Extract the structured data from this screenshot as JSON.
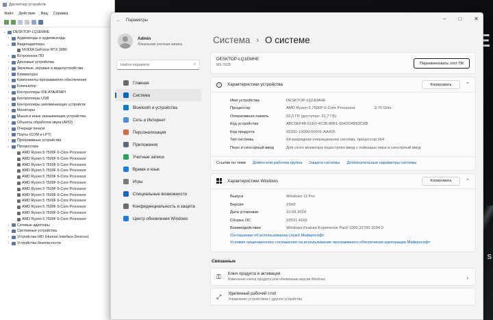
{
  "device_manager": {
    "title": "Диспетчер устройств",
    "menu": [
      "Файл",
      "Действие",
      "Вид",
      "Справка"
    ],
    "root": "DESKTOP-LQ1EMHE",
    "categories": [
      {
        "label": "Аудиовходы и аудиовыходы",
        "expanded": false
      },
      {
        "label": "Видеоадаптеры",
        "expanded": true
      },
      {
        "label": "NVIDIA GeForce RTX 3080",
        "child": true
      },
      {
        "label": "Встроенное ПО",
        "expanded": false
      },
      {
        "label": "Дисковые устройства",
        "expanded": false
      },
      {
        "label": "Звуковые, игровые и видеоустройства",
        "expanded": false
      },
      {
        "label": "Клавиатуры",
        "expanded": false
      },
      {
        "label": "Компоненты программного обеспечения",
        "expanded": false
      },
      {
        "label": "Компьютер",
        "expanded": false
      },
      {
        "label": "Контроллеры IDE ATA/ATAPI",
        "expanded": false
      },
      {
        "label": "Контроллеры USB",
        "expanded": false
      },
      {
        "label": "Контроллеры запоминающих устройств",
        "expanded": false
      },
      {
        "label": "Мониторы",
        "expanded": false
      },
      {
        "label": "Мыши и иные указывающие устройства",
        "expanded": false
      },
      {
        "label": "Объекты обработки звука (APO)",
        "expanded": false
      },
      {
        "label": "Очереди печати",
        "expanded": false
      },
      {
        "label": "Порты (COM и LPT)",
        "expanded": false
      },
      {
        "label": "Программные устройства",
        "expanded": false
      },
      {
        "label": "Процессоры",
        "expanded": true
      }
    ],
    "processors": [
      "AMD Ryzen 5 7500F 6-Core Processor",
      "AMD Ryzen 5 7500F 6-Core Processor",
      "AMD Ryzen 5 7500F 6-Core Processor",
      "AMD Ryzen 5 7500F 6-Core Processor",
      "AMD Ryzen 5 7500F 6-Core Processor",
      "AMD Ryzen 5 7500F 6-Core Processor",
      "AMD Ryzen 5 7500F 6-Core Processor",
      "AMD Ryzen 5 7500F 6-Core Processor",
      "AMD Ryzen 5 7500F 6-Core Processor",
      "AMD Ryzen 5 7500F 6-Core Processor",
      "AMD Ryzen 5 7500F 6-Core Processor",
      "AMD Ryzen 5 7500F 6-Core Processor"
    ],
    "tail_categories": [
      "Сетевые адаптеры",
      "Системные устройства",
      "Устройства HID (Human Interface Devices)",
      "Устройства безопасности"
    ]
  },
  "settings": {
    "title": "Параметры",
    "user": {
      "name": "Admin",
      "sub": "Локальная учетная запись"
    },
    "search_placeholder": "Найти параметр",
    "nav": [
      {
        "label": "Главная",
        "icon": "home-icon",
        "color": "#6b6b6b"
      },
      {
        "label": "Система",
        "icon": "system-icon",
        "color": "#0067c0",
        "active": true
      },
      {
        "label": "Bluetooth и устройства",
        "icon": "bluetooth-icon",
        "color": "#0a7ad1"
      },
      {
        "label": "Сеть и Интернет",
        "icon": "network-icon",
        "color": "#4a8fd6"
      },
      {
        "label": "Персонализация",
        "icon": "brush-icon",
        "color": "#d46a43"
      },
      {
        "label": "Приложения",
        "icon": "apps-icon",
        "color": "#5a6a80"
      },
      {
        "label": "Учетные записи",
        "icon": "account-icon",
        "color": "#2ba35c"
      },
      {
        "label": "Время и язык",
        "icon": "globe-icon",
        "color": "#1a7fd6"
      },
      {
        "label": "Игры",
        "icon": "gamepad-icon",
        "color": "#7a7a7a"
      },
      {
        "label": "Специальные возможности",
        "icon": "accessibility-icon",
        "color": "#1a66c2"
      },
      {
        "label": "Конфиденциальность и защита",
        "icon": "shield-icon",
        "color": "#6b6b6b"
      },
      {
        "label": "Центр обновления Windows",
        "icon": "update-icon",
        "color": "#1a7fd6"
      }
    ],
    "breadcrumb": {
      "parent": "Система",
      "current": "О системе"
    },
    "device": {
      "name": "DESKTOP-LQ1EMHE",
      "model": "MS-7E28",
      "rename_label": "Переименовать этот ПК"
    },
    "device_specs": {
      "title": "Характеристики устройства",
      "copy_label": "Копировать",
      "rows": [
        {
          "k": "Имя устройства",
          "v": "DESKTOP-LQ1EMHE",
          "v2": ""
        },
        {
          "k": "Процессор",
          "v": "AMD Ryzen 5 7500F 6-Core Processor",
          "v2": "3.70 GHz"
        },
        {
          "k": "Оперативная память",
          "v": "32,0 ГБ (доступно: 31,7 ГБ)",
          "v2": ""
        },
        {
          "k": "Код устройства",
          "v": "ABC0EF48-51E0-4C38-88F1-5042D4B62C6B",
          "v2": ""
        },
        {
          "k": "Код продукта",
          "v": "00331-10000-00001-AA425",
          "v2": ""
        },
        {
          "k": "Тип системы",
          "v": "64-разрядная операционная система, процессор x64",
          "v2": ""
        },
        {
          "k": "Перо и сенсорный ввод",
          "v": "Для этого монитора недоступен ввод с помощью пера и сенсорный ввод",
          "v2": ""
        }
      ],
      "links_label": "Ссылки по теме",
      "links": [
        "Домен или рабочая группа",
        "Защита системы",
        "Дополнительные параметры системы"
      ]
    },
    "windows_specs": {
      "title": "Характеристики Windows",
      "copy_label": "Копировать",
      "rows": [
        {
          "k": "Выпуск",
          "v": "Windows 11 Pro"
        },
        {
          "k": "Версия",
          "v": "23H2"
        },
        {
          "k": "Дата установки",
          "v": "10.09.2024"
        },
        {
          "k": "Сборка ОС",
          "v": "22631.4169"
        },
        {
          "k": "Взаимодействие",
          "v": "Windows Feature Experience Pack 1000.22700.1034.0"
        }
      ],
      "links": [
        "Соглашение об использовании служб Майкрософт",
        "Условия лицензионного соглашения на использование программного обеспечения корпорации Майкрософт"
      ]
    },
    "related": {
      "label": "Связанные",
      "tiles": [
        {
          "title": "Ключ продукта и активация",
          "sub": "Изменение ключа продукта или обновление версии Windows"
        },
        {
          "title": "Удаленный рабочий стол",
          "sub": "Управление устройством с другого устройства"
        }
      ]
    }
  }
}
